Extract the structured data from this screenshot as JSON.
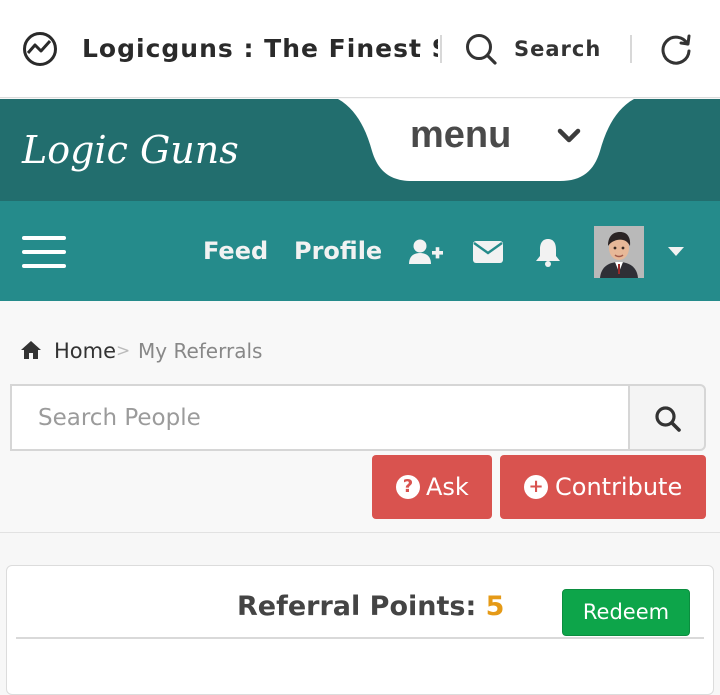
{
  "browser": {
    "page_title": "Logicguns : The Finest S",
    "search_label": "Search"
  },
  "header": {
    "logo_text": "Logic Guns",
    "menu_label": "menu"
  },
  "nav": {
    "links": [
      {
        "label": "Feed"
      },
      {
        "label": "Profile"
      }
    ],
    "icons": [
      "add-user-icon",
      "envelope-icon",
      "bell-icon",
      "avatar",
      "caret-down-icon"
    ]
  },
  "breadcrumb": {
    "home": "Home",
    "separator": ">",
    "current": "My Referrals"
  },
  "search": {
    "placeholder": "Search People",
    "value": ""
  },
  "actions": {
    "ask_label": "Ask",
    "contribute_label": "Contribute"
  },
  "referrals": {
    "points_label": "Referral Points:",
    "points_value": "5",
    "redeem_label": "Redeem"
  },
  "colors": {
    "header_dark": "#226e6e",
    "nav_teal": "#258b8b",
    "danger": "#d9534f",
    "success": "#0da54a",
    "points": "#e59a17"
  }
}
